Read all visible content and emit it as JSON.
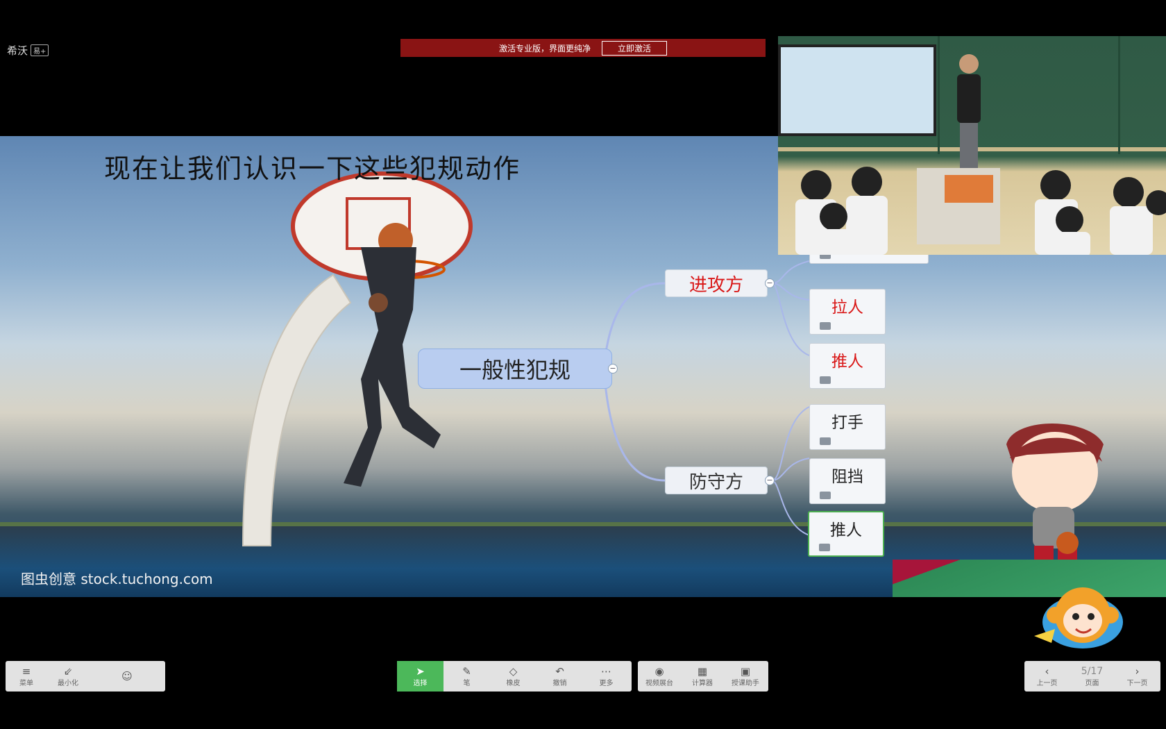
{
  "logo": {
    "text": "希沃",
    "badge": "易+"
  },
  "promo": {
    "message": "激活专业版，界面更纯净",
    "button_label": "立即激活"
  },
  "slide": {
    "title": "现在让我们认识一下这些犯规动作",
    "watermark": "图虫创意 stock.tuchong.com",
    "mindmap": {
      "central": "一般性犯规",
      "attack": {
        "label": "进攻方",
        "leaves": [
          "",
          "拉人",
          "推人"
        ]
      },
      "defense": {
        "label": "防守方",
        "leaves": [
          "打手",
          "阻挡",
          "推人"
        ]
      }
    },
    "colors": {
      "attack_text": "#d91616",
      "central_bg": "#b9cdf0",
      "selected_border": "#4caf50"
    }
  },
  "toolbar": {
    "left": [
      {
        "label": "菜单",
        "icon": "menu-icon"
      },
      {
        "label": "最小化",
        "icon": "minimize-icon"
      },
      {
        "label": "",
        "icon": "avatar-icon"
      }
    ],
    "middle": [
      {
        "label": "选择",
        "icon": "cursor-icon",
        "active": true
      },
      {
        "label": "笔",
        "icon": "pen-icon"
      },
      {
        "label": "橡皮",
        "icon": "eraser-icon"
      },
      {
        "label": "撤销",
        "icon": "undo-icon"
      },
      {
        "label": "更多",
        "icon": "more-icon"
      }
    ],
    "right": [
      {
        "label": "视频展台",
        "icon": "camera-icon"
      },
      {
        "label": "计算器",
        "icon": "calculator-icon"
      },
      {
        "label": "授课助手",
        "icon": "assistant-icon"
      }
    ],
    "pager": {
      "prev": "上一页",
      "page": "5/17",
      "page_label": "页面",
      "next": "下一页"
    }
  }
}
